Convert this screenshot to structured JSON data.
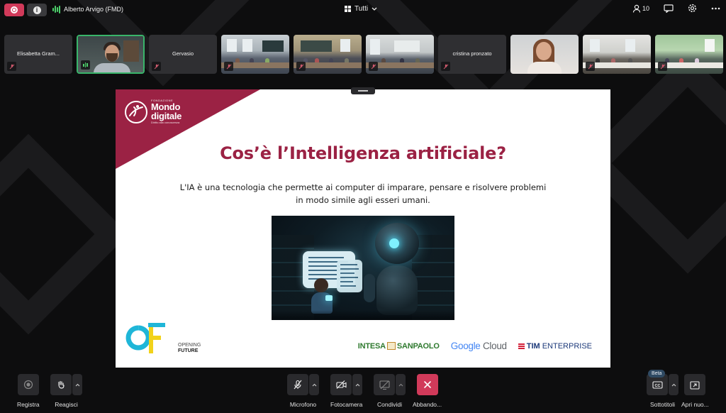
{
  "topbar": {
    "speaker_name": "Alberto Arvigo (FMD)",
    "view_label": "Tutti",
    "participants_count": "10",
    "icons": [
      "record-icon",
      "info-icon",
      "people-icon",
      "chat-icon",
      "settings-icon",
      "more-icon"
    ]
  },
  "participants": [
    {
      "name": "Elisabetta Gram...",
      "type": "name"
    },
    {
      "name": "",
      "type": "man"
    },
    {
      "name": "Gervasio",
      "type": "name"
    },
    {
      "name": "",
      "type": "room"
    },
    {
      "name": "",
      "type": "room"
    },
    {
      "name": "",
      "type": "room"
    },
    {
      "name": "cristina pronzato",
      "type": "name"
    },
    {
      "name": "",
      "type": "person"
    },
    {
      "name": "",
      "type": "room"
    },
    {
      "name": "",
      "type": "room"
    }
  ],
  "slide": {
    "brand_small": "FONDAZIONE",
    "brand_big_1": "Mondo",
    "brand_big_2": "digitale",
    "brand_tag": "Diritto alla conoscenza",
    "title": "Cos’è l’Intelligenza artificiale?",
    "body": "L'IA è una tecnologia che permette ai computer di imparare, pensare e risolvere problemi in modo simile agli esseri umani.",
    "of_line1": "OPENING",
    "of_line2": "FUTURE",
    "sponsor_intesa_1": "INTESA",
    "sponsor_intesa_2": "SANPAOLO",
    "sponsor_google_1": "Google",
    "sponsor_google_2": "Cloud",
    "sponsor_tim_1": "TIM",
    "sponsor_tim_2": "ENTERPRISE",
    "colors": {
      "brand": "#9b2244",
      "of_cyan": "#1fb6d8",
      "of_yellow": "#f2d21a"
    }
  },
  "bottombar": {
    "registra": "Registra",
    "reagisci": "Reagisci",
    "microfono": "Microfono",
    "fotocamera": "Fotocamera",
    "condividi": "Condividi",
    "abbandona": "Abbando...",
    "sottotitoli": "Sottotitoli",
    "apri": "Apri nuo...",
    "beta": "Beta"
  }
}
